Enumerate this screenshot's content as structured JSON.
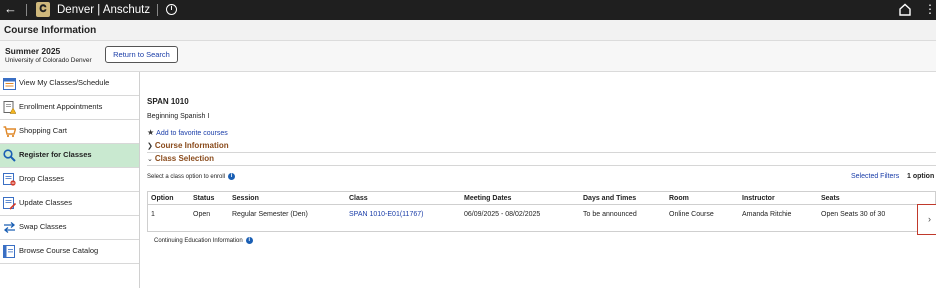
{
  "topbar": {
    "back_icon": "arrow-left-icon",
    "logo_glyph": "CU",
    "brand": "Denver | Anschutz",
    "info_icon": "info-circle-icon",
    "home_icon": "home-icon",
    "more_icon": "vertical-ellipsis-icon"
  },
  "page": {
    "title": "Course Information"
  },
  "term": {
    "name": "Summer 2025",
    "institution": "University of Colorado Denver",
    "return_button": "Return to Search"
  },
  "sidebar": {
    "items": [
      {
        "label": "View My Classes/Schedule",
        "icon": "calendar-icon"
      },
      {
        "label": "Enrollment Appointments",
        "icon": "document-warning-icon"
      },
      {
        "label": "Shopping Cart",
        "icon": "shopping-cart-icon"
      },
      {
        "label": "Register for Classes",
        "icon": "magnifier-icon",
        "active": true
      },
      {
        "label": "Drop Classes",
        "icon": "drop-list-icon"
      },
      {
        "label": "Update Classes",
        "icon": "edit-list-icon"
      },
      {
        "label": "Swap Classes",
        "icon": "swap-arrows-icon"
      },
      {
        "label": "Browse Course Catalog",
        "icon": "catalog-book-icon"
      }
    ]
  },
  "course": {
    "code": "SPAN 1010",
    "title": "Beginning Spanish I",
    "favorite_link": "Add to favorite courses",
    "section_info": "Course Information",
    "section_selection": "Class Selection",
    "select_prompt": "Select a class option to enroll",
    "selected_filters": "Selected Filters",
    "option_count": "1 option",
    "continuing_education": "Continuing Education Information"
  },
  "table": {
    "headers": [
      "Option",
      "Status",
      "Session",
      "Class",
      "Meeting Dates",
      "Days and Times",
      "Room",
      "Instructor",
      "Seats"
    ],
    "rows": [
      [
        "1",
        "Open",
        "Regular Semester (Den)",
        "SPAN 1010-E01(11767)",
        "06/09/2025 - 08/02/2025",
        "To be announced",
        "Online Course",
        "Amanda Ritchie",
        "Open Seats 30 of 30"
      ]
    ],
    "row_action": "›"
  }
}
